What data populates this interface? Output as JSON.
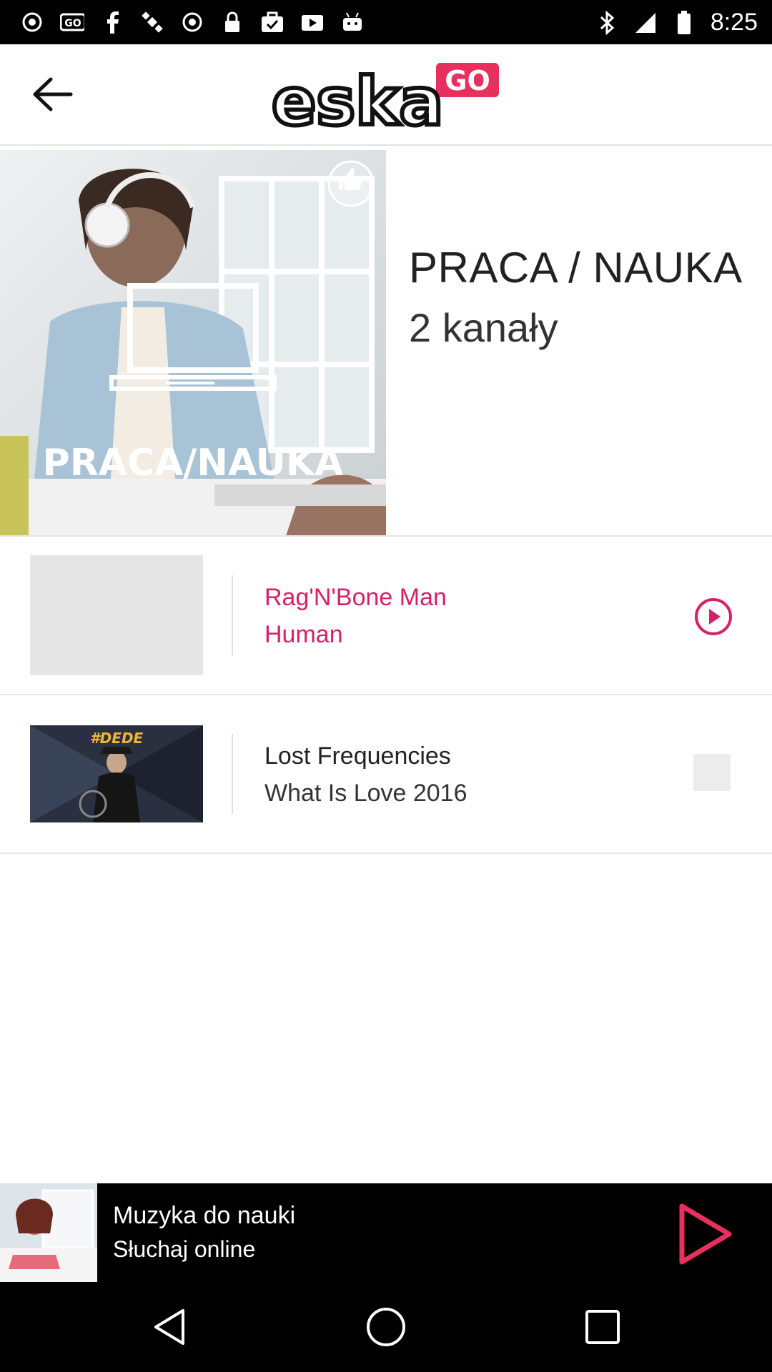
{
  "status_bar": {
    "time": "8:25",
    "left_icons": [
      "record-icon",
      "go-icon",
      "facebook-icon",
      "satellite-icon",
      "record-icon",
      "lock-icon",
      "briefcase-check-icon",
      "play-box-icon",
      "android-icon"
    ],
    "right_icons": [
      "bluetooth-icon",
      "signal-icon",
      "battery-icon"
    ]
  },
  "header": {
    "logo_text": "eska",
    "logo_badge": "GO",
    "logo_badge_color": "#e8305f"
  },
  "category": {
    "image_label": "PRACA/NAUKA",
    "title": "PRACA / NAUKA",
    "count": "2 kanały"
  },
  "tracks": [
    {
      "artist": "Rag'N'Bone Man",
      "song": "Human",
      "active": true,
      "accent_color": "#d4226a",
      "thumb_tag": ""
    },
    {
      "artist": "Lost Frequencies",
      "song": "What Is Love 2016",
      "active": false,
      "accent_color": "#222222",
      "thumb_tag": "#DEDE"
    }
  ],
  "player": {
    "title": "Muzyka do nauki",
    "subtitle": "Słuchaj online",
    "accent_color": "#e8305f"
  },
  "nav": {
    "icons": [
      "back-triangle-icon",
      "home-circle-icon",
      "recents-square-icon"
    ]
  }
}
